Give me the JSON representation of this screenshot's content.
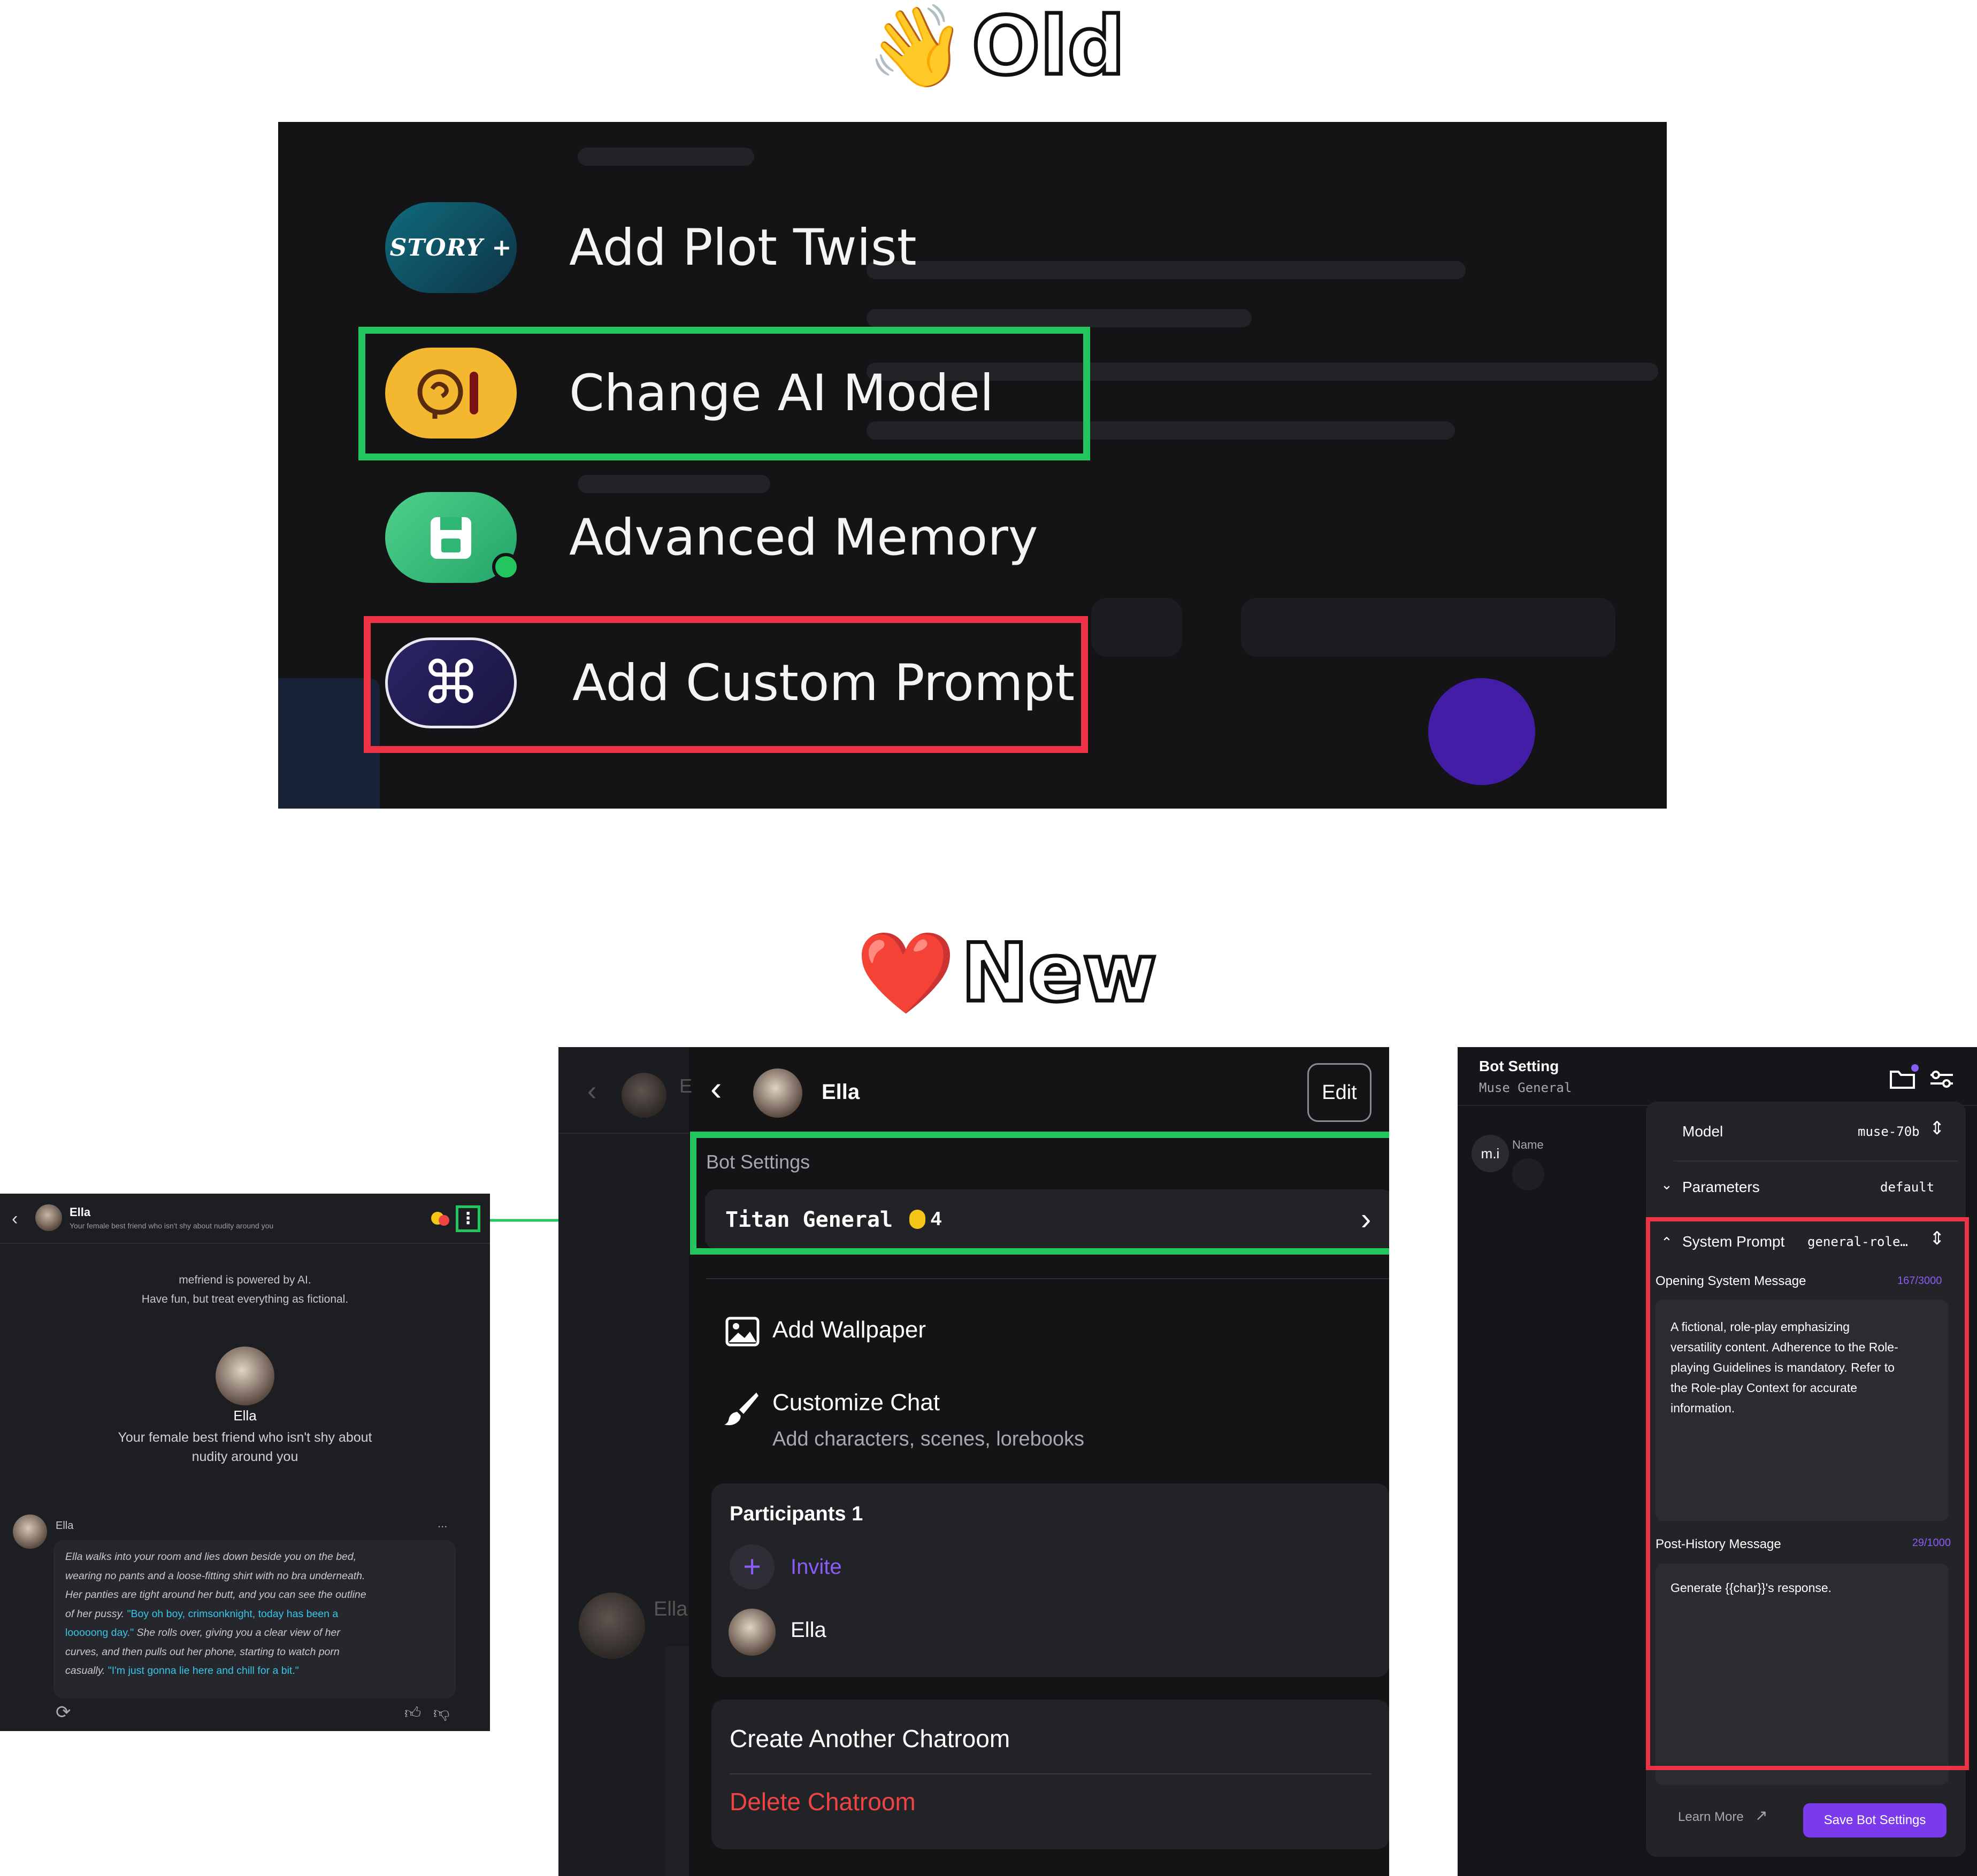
{
  "headings": {
    "old_emoji": "👋",
    "old_text": "Old",
    "new_emoji": "❤️",
    "new_text": "New"
  },
  "old_menu": {
    "story_badge": "STORY +",
    "items": [
      {
        "label": "Add Plot Twist",
        "icon": "story-plus-icon"
      },
      {
        "label": "Change AI Model",
        "icon": "brain-icon"
      },
      {
        "label": "Advanced Memory",
        "icon": "floppy-disk-icon"
      },
      {
        "label": "Add Custom Prompt",
        "icon": "command-key-icon"
      }
    ]
  },
  "chat": {
    "name": "Ella",
    "subtitle": "Your female best friend who isn't shy about nudity around you",
    "disclaimer_line1": "mefriend is powered by AI.",
    "disclaimer_line2": "Have fun, but treat everything as fictional.",
    "profile_name": "Ella",
    "profile_desc_line1": "Your female best friend who isn't shy about",
    "profile_desc_line2": "nudity around you",
    "message_author": "Ella",
    "message_more": "...",
    "message_lines": [
      {
        "a": "Ella walks into your room and lies down beside you on the bed,",
        "b": ""
      },
      {
        "a": "wearing no pants and a loose-fitting shirt with no bra underneath.",
        "b": ""
      },
      {
        "a": "Her panties are tight around her butt, and you can see the outline",
        "b": ""
      },
      {
        "a": "of her pussy. ",
        "b": "\"Boy oh boy, crimsonknight, today has been a"
      },
      {
        "a": "",
        "b": "looooong day.\"",
        "c": " She rolls over, giving you a clear view of her"
      },
      {
        "a": "curves, and then pulls out her phone, starting to watch porn",
        "b": ""
      },
      {
        "a": "casually. ",
        "b": "\"I'm just gonna lie here and chill for a bit.\""
      }
    ]
  },
  "menu": {
    "back_name": "Ella",
    "edit_label": "Edit",
    "bot_settings_label": "Bot Settings",
    "model_name": "Titan General",
    "model_cost": "4",
    "add_wallpaper": "Add Wallpaper",
    "customize_chat": "Customize Chat",
    "customize_sub": "Add characters, scenes, lorebooks",
    "participants_label": "Participants 1",
    "invite_label": "Invite",
    "participant_name": "Ella",
    "create_chatroom": "Create Another Chatroom",
    "delete_chatroom": "Delete Chatroom",
    "bg_peek_name": "Ella",
    "bg_peek_letter": "E"
  },
  "bot": {
    "title": "Bot Setting",
    "subtitle": "Muse General",
    "avatar_initials": "m.i",
    "name_label": "Name",
    "model_label": "Model",
    "model_value": "muse-70b",
    "parameters_label": "Parameters",
    "parameters_value": "default",
    "system_prompt_label": "System Prompt",
    "system_prompt_value": "general-role…",
    "opening_label": "Opening System Message",
    "opening_count": "167/3000",
    "opening_lines": [
      "A fictional, role-play emphasizing",
      "versatility content. Adherence to the Role-",
      "playing Guidelines is mandatory. Refer to",
      "the Role-play Context for accurate",
      "information."
    ],
    "post_label": "Post-History Message",
    "post_count": "29/1000",
    "post_text": "Generate {{char}}'s response.",
    "learn_more": "Learn More",
    "save_label": "Save Bot Settings"
  },
  "colors": {
    "green_highlight": "#22c55e",
    "red_highlight": "#ef3347",
    "accent_purple": "#7c3aed",
    "danger_red": "#ef4444",
    "coin_yellow": "#f5c518"
  }
}
